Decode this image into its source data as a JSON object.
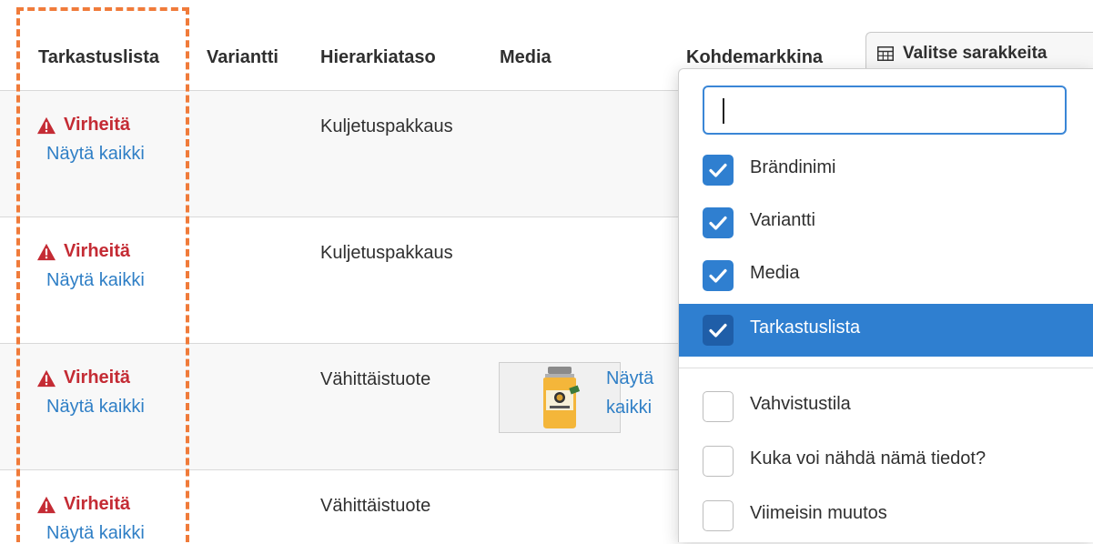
{
  "table": {
    "headers": [
      "Tarkastuslista",
      "Variantti",
      "Hierarkiataso",
      "Media",
      "Kohdemarkkina"
    ],
    "rows": [
      {
        "status": "Virheitä",
        "link": "Näytä kaikki",
        "level": "Kuljetuspakkaus"
      },
      {
        "status": "Virheitä",
        "link": "Näytä kaikki",
        "level": "Kuljetuspakkaus"
      },
      {
        "status": "Virheitä",
        "link": "Näytä kaikki",
        "level": "Vähittäistuote",
        "media_link": "Näytä kaikki"
      },
      {
        "status": "Virheitä",
        "link": "Näytä kaikki",
        "level": "Vähittäistuote"
      }
    ]
  },
  "column_button": {
    "label": "Valitse sarakkeita",
    "icon": "table-icon"
  },
  "column_menu": {
    "search": {
      "value": "",
      "placeholder": ""
    },
    "items": [
      {
        "label": "Brändinimi",
        "checked": true
      },
      {
        "label": "Variantti",
        "checked": true
      },
      {
        "label": "Media",
        "checked": true
      },
      {
        "label": "Tarkastuslista",
        "checked": true,
        "highlighted": true
      },
      {
        "label": "Vahvistustila",
        "checked": false
      },
      {
        "label": "Kuka voi nähdä nämä tiedot?",
        "checked": false
      },
      {
        "label": "Viimeisin muutos",
        "checked": false
      }
    ]
  },
  "colors": {
    "error": "#c42b34",
    "link": "#2f7fc6",
    "accent": "#2f7fd0",
    "highlight": "#f07b3a"
  }
}
